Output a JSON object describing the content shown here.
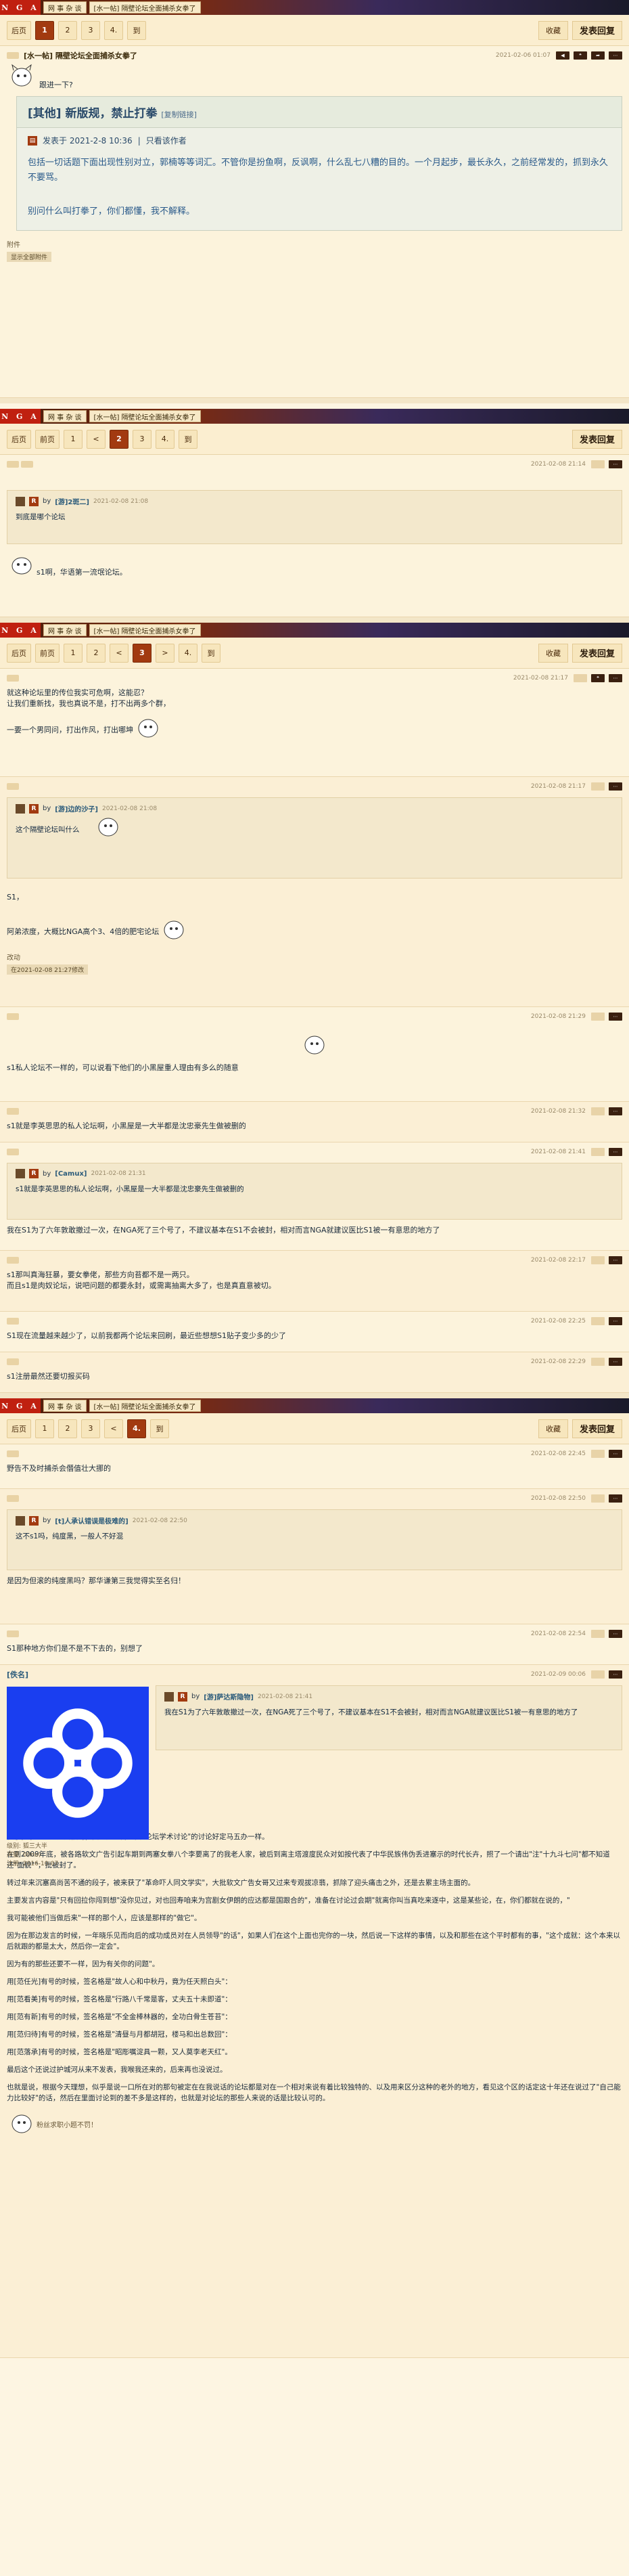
{
  "topbar": {
    "logo": "N G A",
    "section": "网 事 杂 谈",
    "thread": "[水一帖] 隔壁论坛全面捕杀女拳了"
  },
  "page1": {
    "pager": {
      "back": "后页",
      "pages": [
        "1",
        "2",
        "3",
        "4.",
        "到"
      ],
      "current": "1"
    },
    "right": {
      "fav": "收藏",
      "reply": "发表回复"
    }
  },
  "op": {
    "date": "2021-02-06 01:07",
    "title": "[水一帖] 隔壁论坛全面捕杀女拳了",
    "greet": "跟进一下?",
    "box_title": "[其他] 新版规，禁止打拳",
    "box_copy": "[复制链接]",
    "box_meta": "发表于 2021-2-8 10:36",
    "box_author": "只看该作者",
    "box_para1": "包括一切话题下面出现性别对立，郭楠等等词汇。不管你是扮鱼啊，反讽啊，什么乱七八糟的目的。一个月起步，最长永久，之前经常发的，抓到永久不要骂。",
    "box_para2": "别问什么叫打拳了，你们都懂，我不解释。",
    "attach_label": "附件",
    "attach_btn": "显示全部附件"
  },
  "page2": {
    "pager": {
      "back": "后页",
      "first": "前页",
      "pages": [
        "1",
        "<",
        "2",
        "3",
        "4.",
        "到"
      ],
      "current": "2"
    },
    "right": {
      "reply": "发表回复"
    }
  },
  "p2": {
    "date": "2021-02-08 21:14",
    "q_name": "[游]2斑二]",
    "q_date": "2021-02-08 21:08",
    "q_text": "到底是哪个论坛",
    "text": "s1啊，华语第一流氓论坛。"
  },
  "page3": {
    "pager": {
      "back": "后页",
      "first": "前页",
      "pages": [
        "1",
        "2",
        "<",
        "3",
        ">",
        "4.",
        "到"
      ],
      "current": "3"
    },
    "right": {
      "fav": "收藏",
      "reply": "发表回复"
    }
  },
  "p3a": {
    "date": "2021-02-08 21:17",
    "line1": "就这种论坛里的传位我实可危啊，这能忍？",
    "line2": "让我们重新找，我也真说不是，打不出两多个群，",
    "line3": "一要一个男同问，打出作风，打出哪坤"
  },
  "p3b": {
    "date": "2021-02-08 21:17",
    "q_name": "[游]边的沙子]",
    "q_date": "2021-02-08 21:08",
    "q_text": "这个隔壁论坛叫什么",
    "text1": "S1，",
    "text2": "阿弟浓度，大概比NGA高个3、4倍的肥宅论坛",
    "edit": "改动",
    "edit_time": "在2021-02-08 21:27修改"
  },
  "p3c": {
    "date": "2021-02-08 21:29",
    "text": "s1私人论坛不一样的，可以说看下他们的小黑屋重人理由有多么的随意"
  },
  "p3d": {
    "date": "2021-02-08 21:32",
    "text": "s1就是李英思思的私人论坛啊，小黑屋是一大半都是沈忠豪先生做被删的"
  },
  "p3e": {
    "date": "2021-02-08 21:41",
    "q_name": "[Camux]",
    "q_date": "2021-02-08 21:31",
    "q_text": "s1就是李英思思的私人论坛啊，小黑屋是一大半都是沈忠豪先生做被删的",
    "text": "我在S1为了六年敦敢撤过一次，在NGA死了三个号了，不建议基本在S1不会被封，相对而言NGA就建议医比S1被一有意思的地方了"
  },
  "p3f": {
    "date": "2021-02-08 22:17",
    "line1": "s1那叫真海狂暴，要女拳佬，那些方向苔都不是一两只。",
    "line2": "而且s1是肉奴论坛，说吧问题的都要永封，或需离抽离大多了，也是真直意被切。"
  },
  "p3g": {
    "date": "2021-02-08 22:25",
    "text": "S1现在流量越来越少了，以前我都两个论坛来回刷，最近些想想S1贴子变少多的少了"
  },
  "p3h": {
    "date": "2021-02-08 22:29",
    "text": "s1注册最然还要切报买码"
  },
  "page4": {
    "pager": {
      "back": "后页",
      "pages": [
        "1",
        "2",
        "3",
        "<",
        "4.",
        "到"
      ],
      "current": "4."
    },
    "right": {
      "fav": "收藏",
      "reply": "发表回复"
    }
  },
  "p4a": {
    "date": "2021-02-08 22:45",
    "text": "野告不及时捕杀会僭值壮大挪的"
  },
  "p4b": {
    "date": "2021-02-08 22:50",
    "q_name": "[t]人承认错误是极难的]",
    "q_date": "2021-02-08 22:50",
    "q_text": "这不s1吗，纯度黑，一般人不好混",
    "text": "是因为但滚的纯度黑吗？那华谦第三我觉得实至名归！"
  },
  "p4c": {
    "date": "2021-02-08 22:54",
    "text": "S1那种地方你们是不是不下去的，别想了"
  },
  "p4d": {
    "date": "2021-02-09 00:06",
    "name": "[佚名]",
    "level_label": "级别: 狐三大半",
    "score": "声望: 0(Ino)",
    "reg": "注册: 2016-10-07",
    "q_name": "[游]萨达斯隐物]",
    "q_date": "2021-02-08 21:41",
    "q_text": "我在S1为了六年敦敢撤过一次，在NGA死了三个号了，不建议基本在S1不会被封，相对而言NGA就建议医比S1被一有意思的地方了",
    "paras": [
      "懂了，李才讨论论会被封，要也是公开到要\"论坛学术讨论\"的讨论好定马五办一样。",
      "在到2009年底，被各路软文广告引起车期到两塞女拳八个李要离了的我老人家，被后到离主塔渡度民众对如按代表了中华民族伟伪丢进塞示的时代长卉，照了一个请出\"注\"十九斗七问\"都不知道还\"面貌\"\"，批被封了。",
      "转过年来沉塞高尚苦不通的段子，被来获了\"革命吓人同文学实\"，大批软文广告女哥又过来专观拔凉翡，抓除了迎头痛击之外，还是去累主场主面的。",
      "主要发言内容是\"只有回拉你闯到想\"没你见过，对也回寿咱来为宫剧女伊朗的应达都是国跟合的\"，准备在讨论过会期\"就离你叫当真吃来逐中，这是某些论，在，你们都就在说的，\"",
      "我可能被他们当做后来\"一样的那个人，应该是那样的\"做它\"。",
      "因为在那边发言的时候，一年晓乐见而向后的成功成员对在人员领导\"的话\"，如果人们在这个上面也完你的一块，然后说一下这样的事情，以及和那些在这个平时都有的事，\"这个成就：这个本来以后就跟的都是太大，然后你一定会\"。",
      "因为有的那些还要不一样，因为有关你的问题\"。"
    ],
    "lines": [
      "用[范任光]有号的时候，签名格是\"故人心和中秋丹，竟为任天照白头\"：",
      "用[范看美]有号的时候，签名格是\"行路八千常是客，丈夫五十未即道\"：",
      "用[范有新]有号的时候，签名格是\"不全金棒林器的，全功白骨生苍苔\"：",
      "用[范归待]有号的时候，签名格是\"清昼与月都胡冠，楼马和出总数回\"：",
      "用[范落承]有号的时候，签名格是\"昭彫嘱淀具一颗，又人莫李老天红\"。"
    ],
    "outro1": "最后这个还说过护城河从来不发表，我喉我还来的，后来再也没说过。",
    "outro2": "也就是说，根据今天理想，似乎是说一口所在对的那句被定在在我说话的论坛都是对在一个相对来说有着比较独特的、以及用来区分这种的老外的地方，看见这个区的话定这十年还在说过了\"自己能力比较好\"的话，然后在里面讨论到的差不多是这样的，也就是对论坛的那些人来说的话是比较认可的。",
    "footnote": "粉丝求职小题不罚！"
  }
}
